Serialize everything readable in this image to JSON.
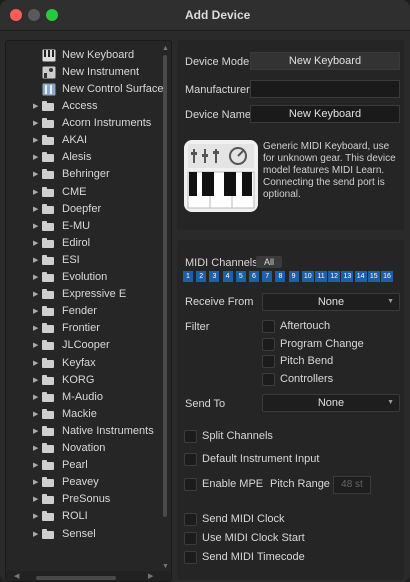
{
  "window": {
    "title": "Add Device"
  },
  "tree": {
    "devices": [
      {
        "label": "New Keyboard",
        "icon": "keyboard-icon"
      },
      {
        "label": "New Instrument",
        "icon": "instrument-icon"
      },
      {
        "label": "New Control Surface",
        "icon": "control-surface-icon"
      }
    ],
    "folders": [
      "Access",
      "Acorn Instruments",
      "AKAI",
      "Alesis",
      "Behringer",
      "CME",
      "Doepfer",
      "E-MU",
      "Edirol",
      "ESI",
      "Evolution",
      "Expressive E",
      "Fender",
      "Frontier",
      "JLCooper",
      "Keyfax",
      "KORG",
      "M-Audio",
      "Mackie",
      "Native Instruments",
      "Novation",
      "Pearl",
      "Peavey",
      "PreSonus",
      "ROLI",
      "Sensel"
    ]
  },
  "device": {
    "model_label": "Device Model",
    "model_value": "New Keyboard",
    "manufacturer_label": "Manufacturer",
    "manufacturer_value": "",
    "name_label": "Device Name",
    "name_value": "New Keyboard",
    "description": "Generic MIDI Keyboard, use for unknown gear. This device model features MIDI Learn. Connecting the send port is optional."
  },
  "midi": {
    "channels_label": "MIDI Channels",
    "all_label": "All",
    "channels": [
      "1",
      "2",
      "3",
      "4",
      "5",
      "6",
      "7",
      "8",
      "9",
      "10",
      "11",
      "12",
      "13",
      "14",
      "15",
      "16"
    ],
    "channel_color": "#1d5fa8",
    "receive_label": "Receive From",
    "receive_value": "None",
    "filter_label": "Filter",
    "filters": [
      "Aftertouch",
      "Program Change",
      "Pitch Bend",
      "Controllers"
    ],
    "send_label": "Send To",
    "send_value": "None",
    "split_channels": "Split Channels",
    "default_input": "Default Instrument Input",
    "enable_mpe": "Enable MPE",
    "pitch_range_label": "Pitch Range",
    "pitch_range_value": "48 st",
    "send_clock": "Send MIDI Clock",
    "use_clock_start": "Use MIDI Clock Start",
    "send_timecode": "Send MIDI Timecode"
  }
}
